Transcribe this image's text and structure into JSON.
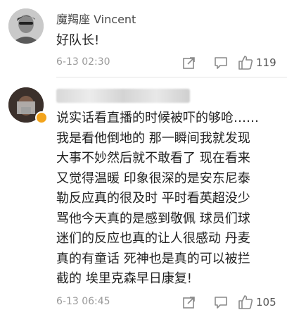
{
  "comments": [
    {
      "username": "魔羯座 Vincent",
      "text": "好队长!",
      "timestamp": "6-13 02:30",
      "likes": "119",
      "icons": [
        "share-icon",
        "comment-icon",
        "like-icon"
      ]
    },
    {
      "username": "",
      "verified": true,
      "text": "说实话看直播的时候被吓的够呛……\n我是看他倒地的 那一瞬间我就发现\n大事不妙然后就不敢看了 现在看来\n又觉得温暖 印象很深的是安东尼泰\n勒反应真的很及时 平时看英超没少\n骂他今天真的是感到敬佩 球员们球\n迷们的反应也真的让人很感动 丹麦\n真的有童话 死神也是真的可以被拦\n截的 埃里克森早日康复!",
      "timestamp": "6-13 06:45",
      "likes": "105",
      "icons": [
        "share-icon",
        "comment-icon",
        "like-icon"
      ]
    }
  ],
  "colors": {
    "verified_badge": "#f3a41c",
    "meta_gray": "#9a9a9a"
  }
}
